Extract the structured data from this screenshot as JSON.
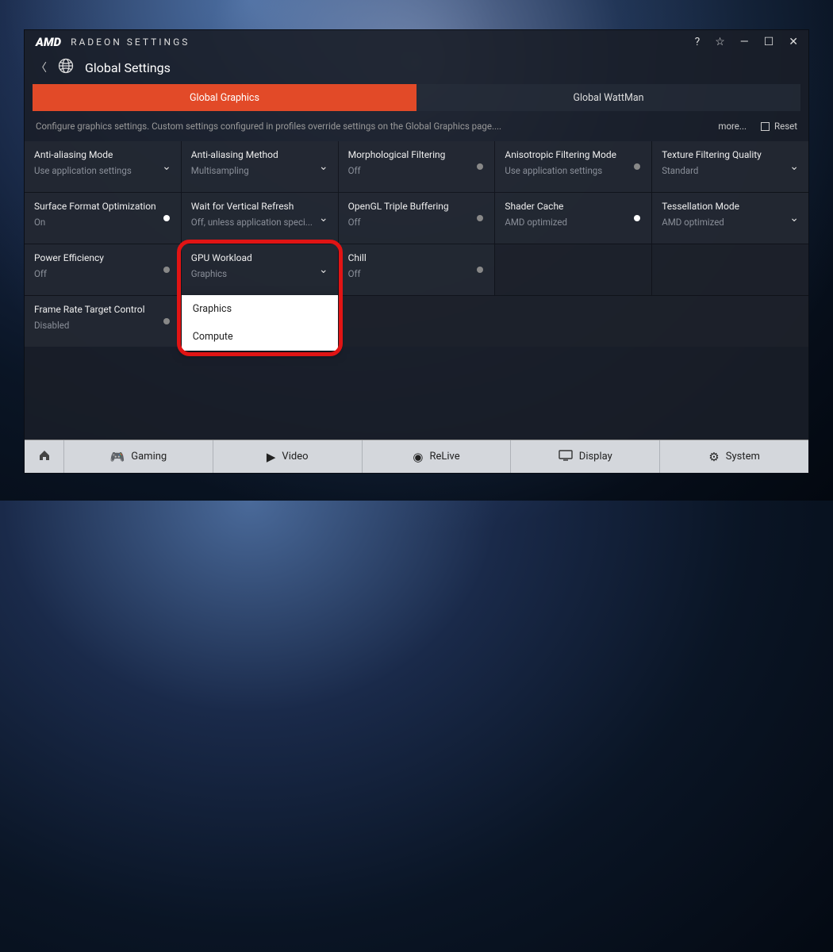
{
  "titlebar": {
    "brand": "AMD",
    "title": "RADEON SETTINGS"
  },
  "header": {
    "page": "Global Settings"
  },
  "tabs": [
    {
      "label": "Global Graphics",
      "active": true
    },
    {
      "label": "Global WattMan",
      "active": false
    }
  ],
  "description": "Configure graphics settings. Custom settings configured in profiles override settings on the Global Graphics page....",
  "toolbar": {
    "more": "more...",
    "reset": "Reset"
  },
  "settings": {
    "aa_mode": {
      "title": "Anti-aliasing Mode",
      "value": "Use application settings",
      "control": "dropdown"
    },
    "aa_method": {
      "title": "Anti-aliasing Method",
      "value": "Multisampling",
      "control": "dropdown"
    },
    "morph_filter": {
      "title": "Morphological Filtering",
      "value": "Off",
      "control": "toggle",
      "on": false
    },
    "aniso_mode": {
      "title": "Anisotropic Filtering Mode",
      "value": "Use application settings",
      "control": "toggle",
      "on": false
    },
    "tex_quality": {
      "title": "Texture Filtering Quality",
      "value": "Standard",
      "control": "dropdown"
    },
    "surface_opt": {
      "title": "Surface Format Optimization",
      "value": "On",
      "control": "toggle",
      "on": true
    },
    "vsync": {
      "title": "Wait for Vertical Refresh",
      "value": "Off, unless application speci...",
      "control": "dropdown"
    },
    "triple_buf": {
      "title": "OpenGL Triple Buffering",
      "value": "Off",
      "control": "toggle",
      "on": false
    },
    "shader_cache": {
      "title": "Shader Cache",
      "value": "AMD optimized",
      "control": "toggle",
      "on": true
    },
    "tess_mode": {
      "title": "Tessellation Mode",
      "value": "AMD optimized",
      "control": "dropdown"
    },
    "power_eff": {
      "title": "Power Efficiency",
      "value": "Off",
      "control": "toggle",
      "on": false
    },
    "gpu_workload": {
      "title": "GPU Workload",
      "value": "Graphics",
      "control": "dropdown",
      "options": [
        "Graphics",
        "Compute"
      ]
    },
    "chill": {
      "title": "Chill",
      "value": "Off",
      "control": "toggle",
      "on": false
    },
    "frtc": {
      "title": "Frame Rate Target Control",
      "value": "Disabled",
      "control": "toggle",
      "on": false
    }
  },
  "bottomnav": {
    "gaming": "Gaming",
    "video": "Video",
    "relive": "ReLive",
    "display": "Display",
    "system": "System"
  }
}
